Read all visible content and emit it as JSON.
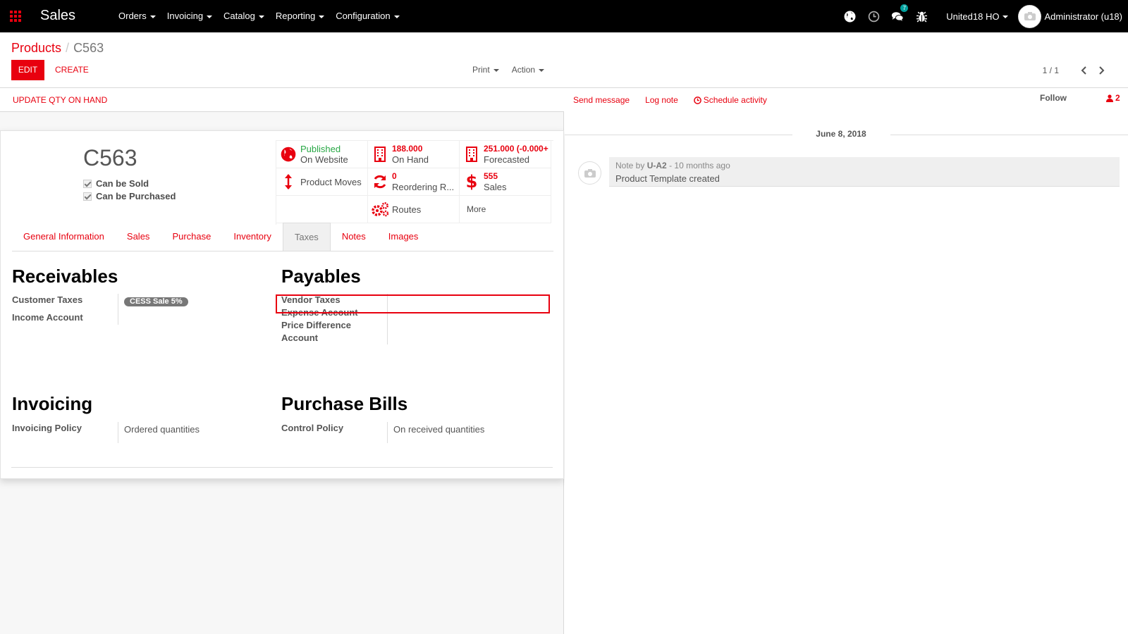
{
  "topbar": {
    "app_title": "Sales",
    "menu": [
      "Orders",
      "Invoicing",
      "Catalog",
      "Reporting",
      "Configuration"
    ],
    "chat_badge": "7",
    "company": "United18 HO",
    "user": "Administrator (u18)"
  },
  "breadcrumb": {
    "parent": "Products",
    "separator": "/",
    "current": "C563"
  },
  "buttons": {
    "edit": "EDIT",
    "create": "CREATE",
    "print": "Print",
    "action": "Action",
    "update_qty": "UPDATE QTY ON HAND"
  },
  "pager": {
    "value": "1 / 1"
  },
  "product": {
    "name": "C563",
    "can_be_sold": "Can be Sold",
    "can_be_purchased": "Can be Purchased"
  },
  "smart_buttons": {
    "published_value": "Published",
    "published_label": "On Website",
    "onhand_value": "188.000",
    "onhand_label": "On Hand",
    "forecast_value": "251.000 (-0.000+",
    "forecast_label": "Forecasted",
    "moves_label": "Product Moves",
    "reorder_value": "0",
    "reorder_label": "Reordering R...",
    "sales_value": "555",
    "sales_label": "Sales",
    "routes_label": "Routes",
    "more_label": "More"
  },
  "tabs": [
    "General Information",
    "Sales",
    "Purchase",
    "Inventory",
    "Taxes",
    "Notes",
    "Images"
  ],
  "active_tab": "Taxes",
  "receivables": {
    "title": "Receivables",
    "customer_taxes_label": "Customer Taxes",
    "customer_taxes_tag": "CESS Sale 5%",
    "income_account_label": "Income Account"
  },
  "payables": {
    "title": "Payables",
    "vendor_taxes_label": "Vendor Taxes",
    "expense_account_label": "Expense Account",
    "price_diff_line1": "Price Difference",
    "price_diff_line2": "Account"
  },
  "invoicing": {
    "title": "Invoicing",
    "policy_label": "Invoicing Policy",
    "policy_value": "Ordered quantities"
  },
  "purchase_bills": {
    "title": "Purchase Bills",
    "control_label": "Control Policy",
    "control_value": "On received quantities"
  },
  "chatter": {
    "send_message": "Send message",
    "log_note": "Log note",
    "schedule_activity": "Schedule activity",
    "follow": "Follow",
    "followers_count": "2",
    "date": "June 8, 2018",
    "note_prefix": "Note by",
    "note_author": "U-A2",
    "note_time": "- 10 months ago",
    "note_body": "Product Template created"
  },
  "colors": {
    "accent": "#e8000f",
    "topbar": "#000000",
    "published": "#28a745",
    "badge": "#00a09d"
  }
}
